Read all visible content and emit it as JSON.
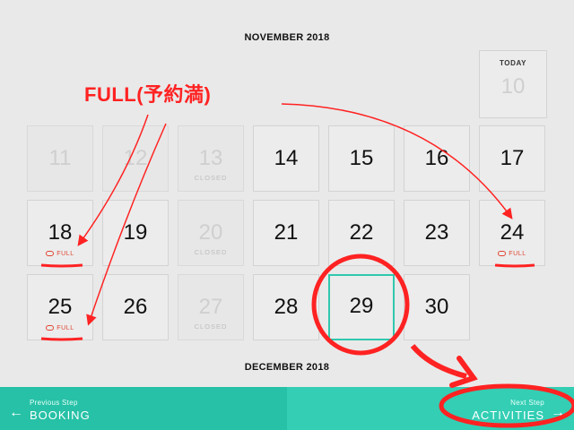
{
  "calendar": {
    "month_current": "NOVEMBER 2018",
    "month_next": "DECEMBER 2018",
    "today": {
      "label": "TODAY",
      "day": "10"
    },
    "closed_label": "CLOSED",
    "full_label": "FULL",
    "days": {
      "d11": "11",
      "d12": "12",
      "d13": "13",
      "d14": "14",
      "d15": "15",
      "d16": "16",
      "d17": "17",
      "d18": "18",
      "d19": "19",
      "d20": "20",
      "d21": "21",
      "d22": "22",
      "d23": "23",
      "d24": "24",
      "d25": "25",
      "d26": "26",
      "d27": "27",
      "d28": "28",
      "d29": "29",
      "d30": "30"
    }
  },
  "footer": {
    "prev_small": "Previous Step",
    "prev_big": "BOOKING",
    "next_small": "Next Step",
    "next_big": "ACTIVITIES"
  },
  "annotation": {
    "title": "FULL(予約満)",
    "color": "#ff2222"
  },
  "colors": {
    "accent": "#26c1a6",
    "selected_border": "#2fc8ad",
    "full_red": "#e0442f"
  }
}
